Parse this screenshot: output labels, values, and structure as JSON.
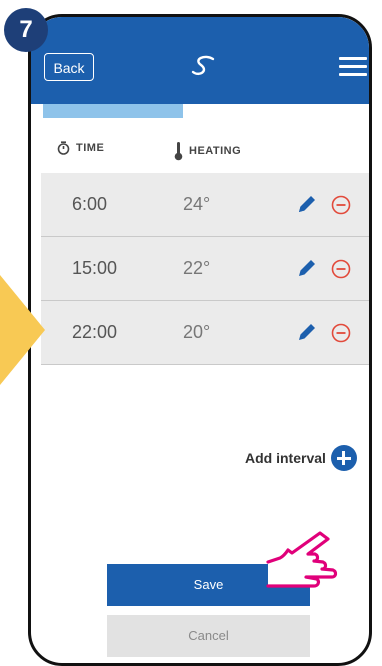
{
  "step_number": "7",
  "header": {
    "back_label": "Back"
  },
  "columns": {
    "time": "TIME",
    "heating": "HEATING"
  },
  "intervals": [
    {
      "time": "6:00",
      "temp": "24°"
    },
    {
      "time": "15:00",
      "temp": "22°"
    },
    {
      "time": "22:00",
      "temp": "20°"
    }
  ],
  "add_interval_label": "Add interval",
  "save_label": "Save",
  "cancel_label": "Cancel",
  "colors": {
    "primary": "#1c5fad",
    "badge": "#1e3f78",
    "arrow": "#f8c954",
    "remove": "#e24a3b",
    "hand": "#e0007a"
  }
}
